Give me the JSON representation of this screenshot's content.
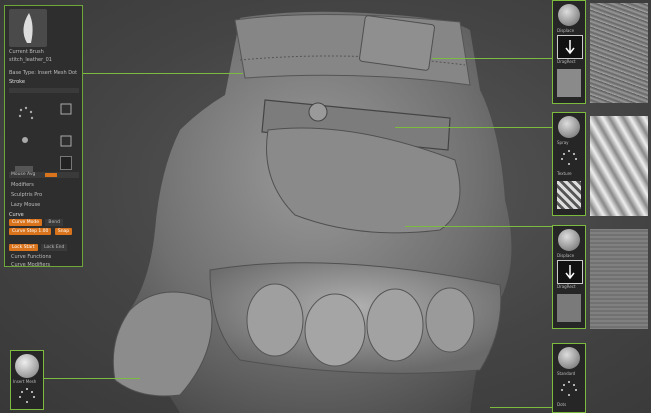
{
  "brush_panel": {
    "title": "Current Brush",
    "brush_name": "stitch_leather_01",
    "base_type": "Base Type: Insert Mesh Dot",
    "stroke_menu": "Stroke",
    "menu_items": [
      "Mouse Avg",
      "Modifiers",
      "Sculptris Pro",
      "Lazy Mouse",
      "Curve"
    ],
    "curve_mode": "Curve Mode",
    "curve_bend": "Bend",
    "curve_step": "Curve Step 1.00",
    "curve_snap": "Snap",
    "curve_lock_start": "Lock Start",
    "curve_lock_end": "Lock End",
    "curve_functions": "Curve Functions",
    "curve_modifiers": "Curve Modifiers"
  },
  "right_panels": [
    {
      "brush": "Displace",
      "alpha": "DragRect"
    },
    {
      "brush": "Spray",
      "alpha": "Texture"
    },
    {
      "brush": "Displace",
      "alpha": "DragRect"
    },
    {
      "brush": "Standard",
      "alpha": "Dots"
    }
  ],
  "bottom_left": {
    "brush": "Insert Mesh"
  },
  "colors": {
    "accent": "#7dbb40",
    "active": "#d9741d",
    "panel": "#2e2e2e"
  }
}
